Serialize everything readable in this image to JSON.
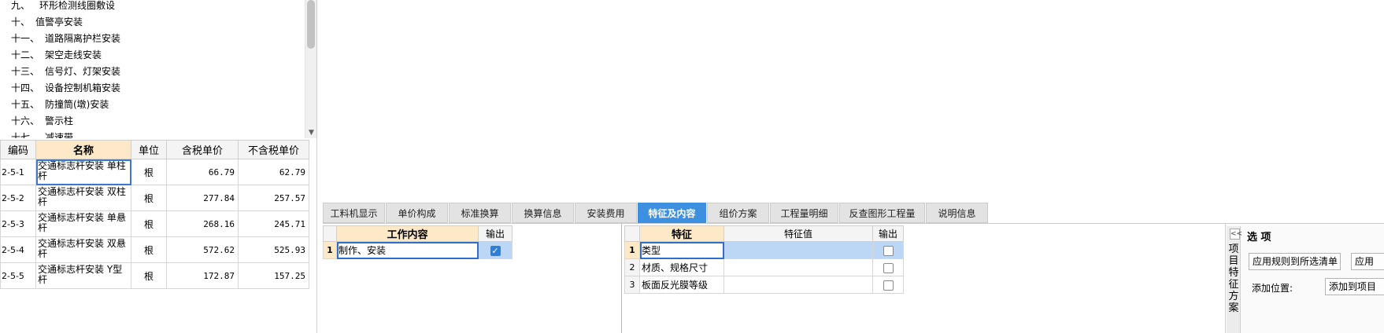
{
  "tree": {
    "items": [
      {
        "num": "九、",
        "text": "环形检测线圈敷设"
      },
      {
        "num": "十、",
        "text": "值警亭安装"
      },
      {
        "num": "十一、",
        "text": "道路隔离护栏安装"
      },
      {
        "num": "十二、",
        "text": "架空走线安装"
      },
      {
        "num": "十三、",
        "text": "信号灯、灯架安装"
      },
      {
        "num": "十四、",
        "text": "设备控制机箱安装"
      },
      {
        "num": "十五、",
        "text": "防撞筒(墩)安装"
      },
      {
        "num": "十六、",
        "text": "警示柱"
      },
      {
        "num": "十七、",
        "text": "减速带"
      }
    ]
  },
  "quota_table": {
    "headers": {
      "code": "编码",
      "name": "名称",
      "unit": "单位",
      "tax_price": "含税单价",
      "notax_price": "不含税单价"
    },
    "rows": [
      {
        "code": "2-5-1",
        "name": "交通标志杆安装 单柱杆",
        "unit": "根",
        "tax_price": "66.79",
        "notax_price": "62.79"
      },
      {
        "code": "2-5-2",
        "name": "交通标志杆安装 双柱杆",
        "unit": "根",
        "tax_price": "277.84",
        "notax_price": "257.57"
      },
      {
        "code": "2-5-3",
        "name": "交通标志杆安装 单悬杆",
        "unit": "根",
        "tax_price": "268.16",
        "notax_price": "245.71"
      },
      {
        "code": "2-5-4",
        "name": "交通标志杆安装 双悬杆",
        "unit": "根",
        "tax_price": "572.62",
        "notax_price": "525.93"
      },
      {
        "code": "2-5-5",
        "name": "交通标志杆安装 Y型杆",
        "unit": "根",
        "tax_price": "172.87",
        "notax_price": "157.25"
      }
    ]
  },
  "tabs": [
    {
      "label": "工料机显示"
    },
    {
      "label": "单价构成"
    },
    {
      "label": "标准换算"
    },
    {
      "label": "换算信息"
    },
    {
      "label": "安装费用"
    },
    {
      "label": "特征及内容",
      "active": true
    },
    {
      "label": "组价方案"
    },
    {
      "label": "工程量明细"
    },
    {
      "label": "反查图形工程量"
    },
    {
      "label": "说明信息"
    }
  ],
  "work_grid": {
    "headers": {
      "content": "工作内容",
      "output": "输出"
    },
    "rows": [
      {
        "no": "1",
        "content": "制作、安装",
        "checked": true
      }
    ]
  },
  "feature_grid": {
    "headers": {
      "feature": "特征",
      "value": "特征值",
      "output": "输出"
    },
    "rows": [
      {
        "no": "1",
        "feature": "类型",
        "value": "",
        "checked": false
      },
      {
        "no": "2",
        "feature": "材质、规格尺寸",
        "value": "",
        "checked": false
      },
      {
        "no": "3",
        "feature": "板面反光膜等级",
        "value": "",
        "checked": false
      }
    ]
  },
  "options": {
    "collapse_glyph": "<<",
    "vertical_title": "项目特征方案",
    "title": "选 项",
    "apply_rule_button": "应用规则到所选清单",
    "apply_button": "应用",
    "position_label": "添加位置:",
    "position_value": "添加到项目"
  },
  "colors": {
    "active_tab": "#3d8fe0",
    "header_highlight": "#fde9c8",
    "selection_blue": "#bcd7f5",
    "checkbox_checked": "#2f7fd8"
  }
}
